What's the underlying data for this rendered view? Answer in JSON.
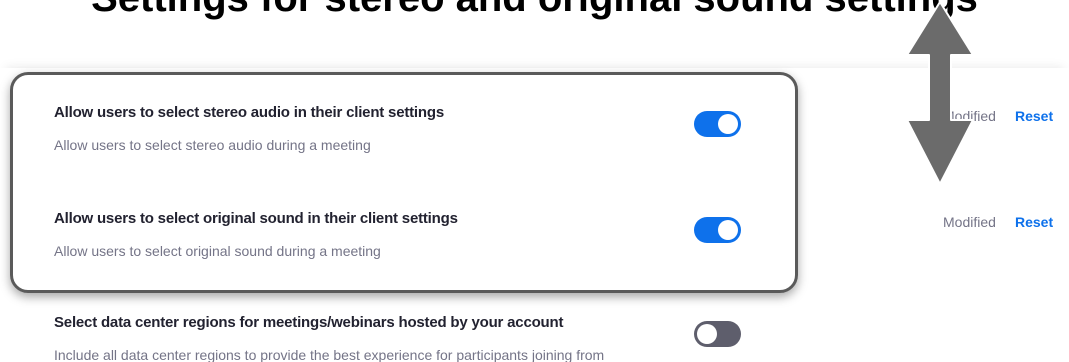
{
  "heading": "Settings for stereo and original sound settings",
  "settings": [
    {
      "title": "Allow users to select stereo audio in their client settings",
      "description": "Allow users to select stereo audio during a meeting",
      "state": "on",
      "status": "Modified",
      "action": "Reset"
    },
    {
      "title": "Allow users to select original sound in their client settings",
      "description": "Allow users to select original sound during a meeting",
      "state": "on",
      "status": "Modified",
      "action": "Reset"
    },
    {
      "title": "Select data center regions for meetings/webinars hosted by your account",
      "description": "Include all data center regions to provide the best experience for participants joining from",
      "state": "off"
    }
  ],
  "colors": {
    "toggle_on": "#0e71eb",
    "toggle_off": "#5e5e6c",
    "link": "#0e71eb",
    "highlight_border": "#5a5a5a",
    "arrow": "#6b6b6b"
  },
  "icons": {
    "annotation": "double-headed-vertical-arrow-icon"
  }
}
